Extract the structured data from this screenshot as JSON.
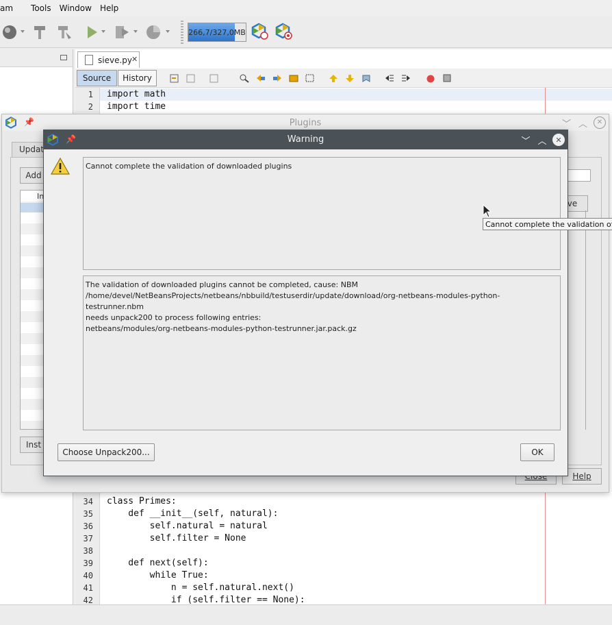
{
  "menubar": {
    "items": [
      {
        "label": "am",
        "underline": "am"
      },
      {
        "label": "Tools",
        "underline": "T"
      },
      {
        "label": "Window",
        "underline": "W"
      },
      {
        "label": "Help",
        "underline": "H"
      }
    ]
  },
  "toolbar": {
    "memory_label": "266,7/327,0MB",
    "memory_fraction": 0.815
  },
  "editor": {
    "file_tab": "sieve.py",
    "source_tab": "Source",
    "history_tab": "History",
    "top_lines": [
      {
        "n": "1",
        "code": "import math"
      },
      {
        "n": "2",
        "code": "import time"
      }
    ],
    "bottom_lines": [
      {
        "n": "34",
        "code": "class Primes:"
      },
      {
        "n": "35",
        "code": "    def __init__(self, natural):"
      },
      {
        "n": "36",
        "code": "        self.natural = natural"
      },
      {
        "n": "37",
        "code": "        self.filter = None"
      },
      {
        "n": "38",
        "code": ""
      },
      {
        "n": "39",
        "code": "    def next(self):"
      },
      {
        "n": "40",
        "code": "        while True:"
      },
      {
        "n": "41",
        "code": "            n = self.natural.next()"
      },
      {
        "n": "42",
        "code": "            if (self.filter == None):"
      }
    ]
  },
  "plugins_dialog": {
    "title": "Plugins",
    "tab_label": "Update",
    "add_button": "Add",
    "list_header": "In",
    "details_button": "ve",
    "install_button": "Inst",
    "close_button": "Close",
    "help_button": "Help"
  },
  "warning_dialog": {
    "title": "Warning",
    "message": "Cannot complete the validation of downloaded plugins",
    "details": [
      "The validation of downloaded plugins cannot be completed, cause: NBM",
      "/home/devel/NetBeansProjects/netbeans/nbbuild/testuserdir/update/download/org-netbeans-modules-python-testrunner.nbm",
      "needs unpack200 to process following entries:",
      "netbeans/modules/org-netbeans-modules-python-testrunner.jar.pack.gz"
    ],
    "choose_button": "Choose Unpack200...",
    "ok_button": "OK"
  },
  "tooltip": {
    "text": "Cannot complete the validation of d"
  },
  "colors": {
    "warning_titlebar": "#4a5157",
    "selection": "#c7d9ef",
    "memory_fill": "#2d74c9",
    "margin_line": "#e38f8f"
  }
}
